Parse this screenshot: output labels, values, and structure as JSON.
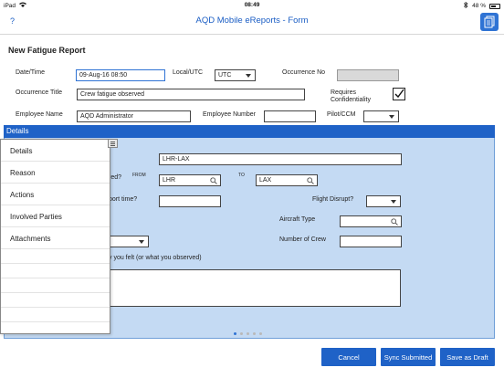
{
  "status_bar": {
    "carrier": "iPad",
    "time": "08:49",
    "battery": "48 %",
    "battery_level": 0.48
  },
  "header": {
    "help": "?",
    "title": "AQD Mobile eReports - Form"
  },
  "form": {
    "title": "New Fatigue Report",
    "date_time_label": "Date/Time",
    "date_time_value": "09-Aug-16 08:50",
    "local_utc_label": "Local/UTC",
    "local_utc_value": "UTC",
    "occurrence_no_label": "Occurrence No",
    "occurrence_title_label": "Occurrence Title",
    "occurrence_title_value": "Crew fatigue observed",
    "requires_conf_label_1": "Requires",
    "requires_conf_label_2": "Confidentiality",
    "requires_conf_checked": true,
    "employee_name_label": "Employee Name",
    "employee_name_value": "AQD Administrator",
    "employee_number_label": "Employee Number",
    "pilot_ccm_label": "Pilot/CCM"
  },
  "details": {
    "header": "Details",
    "route_value": "LHR-LAX",
    "red_label": "red?",
    "from_label": "FROM",
    "from_value": "LHR",
    "to_label": "TO",
    "to_value": "LAX",
    "report_time_label": "port time?",
    "flight_disrupt_label": "Flight Disrupt?",
    "aircraft_type_label": "Aircraft Type",
    "number_of_crew_label": "Number of Crew",
    "felt_label": "y you felt (or what you observed)",
    "pages": 5,
    "current_page": 1
  },
  "menu": {
    "items": [
      "Details",
      "Reason",
      "Actions",
      "Involved Parties",
      "Attachments"
    ]
  },
  "buttons": {
    "cancel": "Cancel",
    "sync": "Sync Submitted",
    "save": "Save as Draft"
  }
}
